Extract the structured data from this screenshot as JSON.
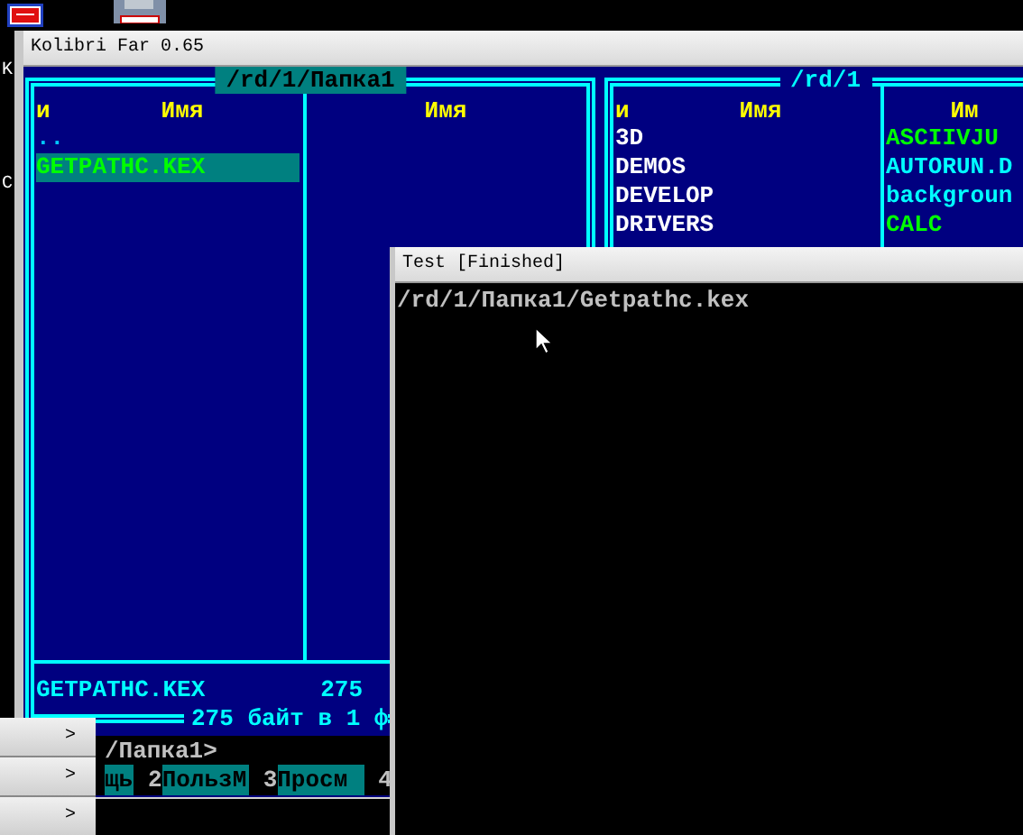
{
  "desktop": {
    "labels": [
      "K",
      "C"
    ]
  },
  "far_window": {
    "title": "Kolibri Far 0.65",
    "left_panel": {
      "path": "/rd/1/Папка1",
      "headers": [
        "и",
        "Имя",
        "Имя"
      ],
      "column_1": [
        {
          "name": "..",
          "kind": "up",
          "selected": false
        },
        {
          "name": "GETPATHC.KEX",
          "kind": "exe",
          "selected": true
        }
      ],
      "info_name": "GETPATHC.KEX",
      "info_size": "275",
      "summary": "275 байт в 1 ф"
    },
    "right_panel": {
      "path": "/rd/1",
      "headers": [
        "и",
        "Имя",
        "Им"
      ],
      "column_1": [
        {
          "name": "3D",
          "kind": "dir",
          "selected": false
        },
        {
          "name": "DEMOS",
          "kind": "dir",
          "selected": false
        },
        {
          "name": "DEVELOP",
          "kind": "dir",
          "selected": false
        },
        {
          "name": "DRIVERS",
          "kind": "dir",
          "selected": false
        }
      ],
      "column_2": [
        {
          "name": "ASCIIVJU",
          "kind": "exe",
          "selected": false
        },
        {
          "name": "AUTORUN.D",
          "kind": "file",
          "selected": false
        },
        {
          "name": "backgroun",
          "kind": "file",
          "selected": false
        },
        {
          "name": "CALC",
          "kind": "exe",
          "selected": false
        }
      ]
    },
    "command_line": "/Папка1>",
    "key_bar": [
      {
        "label": "щь"
      },
      {
        "num": "2",
        "label": "ПользМ"
      },
      {
        "num": "3",
        "label": "Просм"
      },
      {
        "num": "4"
      }
    ]
  },
  "popup_menu": [
    ">",
    ">",
    ">"
  ],
  "test_window": {
    "title": "Test [Finished]",
    "output": "/rd/1/Папка1/Getpathc.kex"
  }
}
